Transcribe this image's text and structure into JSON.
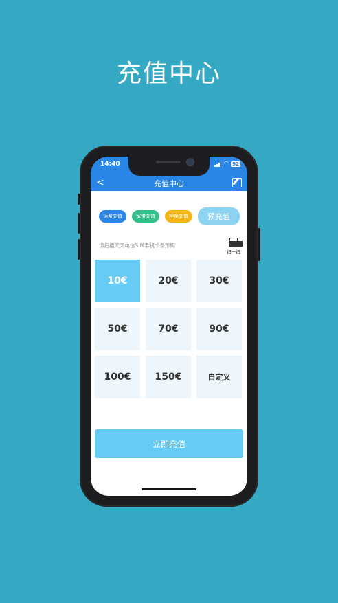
{
  "headline": "充值中心",
  "status": {
    "time": "14:40",
    "battery": "92"
  },
  "nav": {
    "back": "<",
    "title": "充值中心"
  },
  "chips": [
    {
      "label": "话费充值",
      "color": "#2a86e6"
    },
    {
      "label": "宽带充值",
      "color": "#34c08a"
    },
    {
      "label": "押金充值",
      "color": "#f5b516"
    }
  ],
  "prepay_label": "预充值",
  "scan": {
    "hint": "请扫描天天电信SIM手机卡条形码",
    "label": "扫一扫"
  },
  "amounts": [
    "10€",
    "20€",
    "30€",
    "50€",
    "70€",
    "90€",
    "100€",
    "150€",
    "自定义"
  ],
  "selected_amount": "10€",
  "pay_button": "立即充值",
  "colors": {
    "background": "#35a8c3",
    "accent": "#2a86e6",
    "selected": "#66cbf5"
  }
}
